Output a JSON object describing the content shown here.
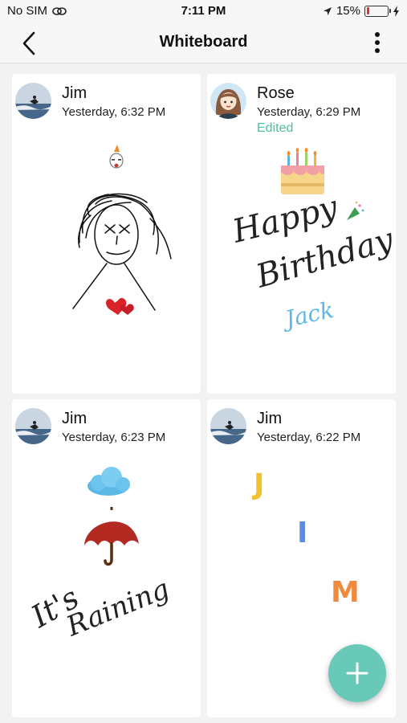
{
  "status_bar": {
    "carrier": "No SIM",
    "time": "7:11 PM",
    "battery": "15%",
    "battery_level": 0.15,
    "battery_color": "#e0312f"
  },
  "nav": {
    "title": "Whiteboard",
    "back_icon": "chevron-left-icon",
    "more_icon": "more-vertical-icon"
  },
  "posts": [
    {
      "author": "Jim",
      "time": "Yesterday, 6:32 PM",
      "edited": "",
      "drawing": "stick-figure-with-hearts"
    },
    {
      "author": "Rose",
      "time": "Yesterday, 6:29 PM",
      "edited": "Edited",
      "drawing_text": [
        "Happy",
        "Birthday",
        "Jack"
      ]
    },
    {
      "author": "Jim",
      "time": "Yesterday, 6:23 PM",
      "edited": "",
      "drawing_text": [
        "It's",
        "Raining"
      ]
    },
    {
      "author": "Jim",
      "time": "Yesterday, 6:22 PM",
      "edited": "",
      "drawing_text": [
        "J",
        "I",
        "M"
      ]
    }
  ],
  "fab": {
    "icon": "plus-icon",
    "color": "#68c9b8"
  }
}
